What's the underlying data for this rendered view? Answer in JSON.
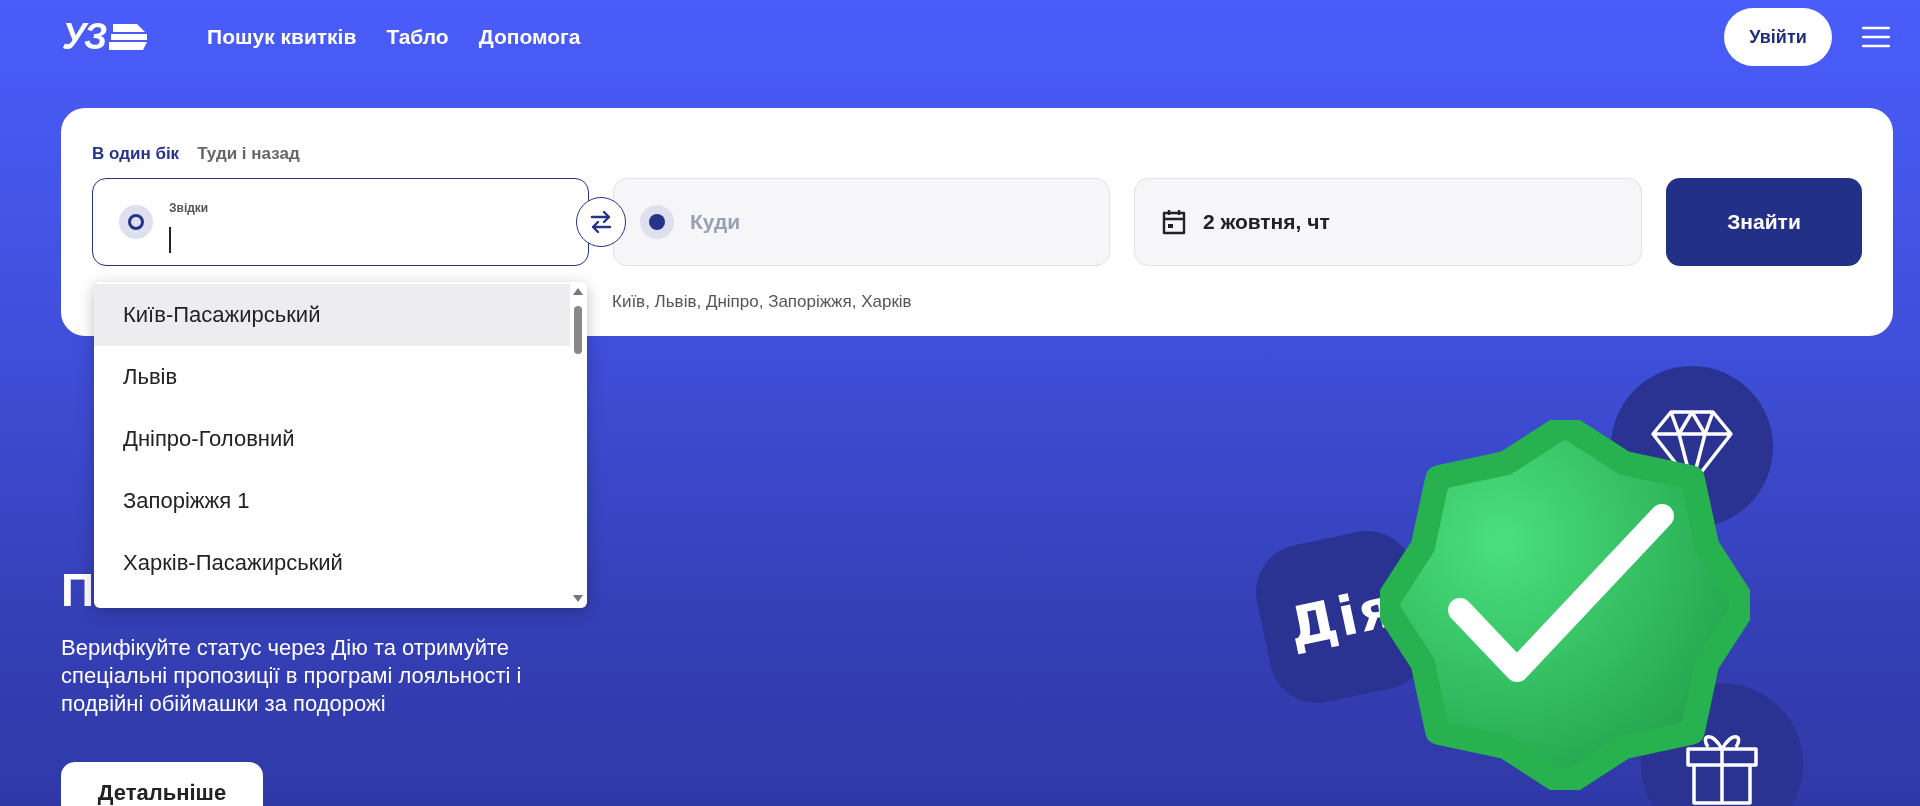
{
  "header": {
    "logo": "УЗ",
    "nav": [
      "Пошук квитків",
      "Табло",
      "Допомога"
    ],
    "login": "Увійти"
  },
  "search": {
    "trip_types": [
      {
        "label": "В один бік",
        "selected": true
      },
      {
        "label": "Туди і назад",
        "selected": false
      }
    ],
    "from": {
      "label": "Звідки",
      "focused": true
    },
    "to": {
      "placeholder": "Куди",
      "hint": "Київ, Львів, Дніпро, Запоріжжя, Харків"
    },
    "date": {
      "value": "2 жовтня, чт"
    },
    "submit": "Знайти",
    "suggestions": [
      {
        "name": "Київ-Пасажирський",
        "selected": true
      },
      {
        "name": "Львів",
        "selected": false
      },
      {
        "name": "Дніпро-Головний",
        "selected": false
      },
      {
        "name": "Запоріжжя 1",
        "selected": false
      },
      {
        "name": "Харків-Пасажирський",
        "selected": false
      }
    ]
  },
  "promo": {
    "heading": "П",
    "text": "Верифікуйте статус через Дію та отримуйте спеціальні пропозиції в програмі лояльності і подвійні обіймашки за подорожі",
    "button": "Детальніше",
    "badge": "Дія"
  }
}
